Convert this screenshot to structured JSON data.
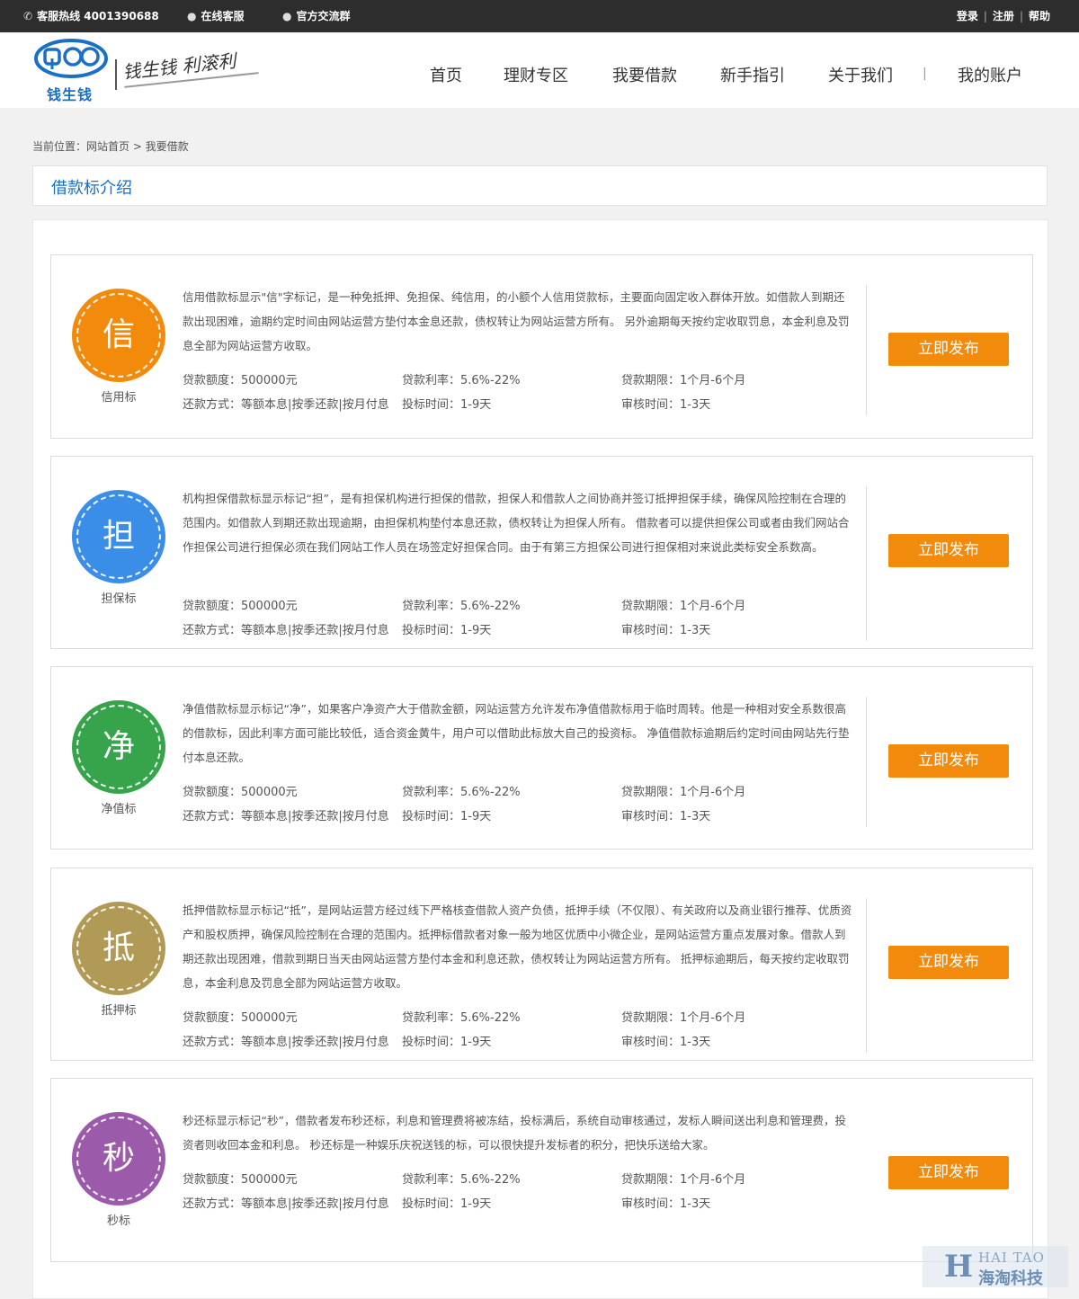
{
  "topbar": {
    "hotline": "客服热线 4001390688",
    "online_service": "在线客服",
    "group": "官方交流群",
    "login": "登录",
    "register": "注册",
    "help": "帮助",
    "sep": "|"
  },
  "header": {
    "logo_text": "钱生钱",
    "slogan": "钱生钱 利滚利",
    "nav": [
      "首页",
      "理财专区",
      "我要借款",
      "新手指引",
      "关于我们",
      "|",
      "我的账户"
    ]
  },
  "breadcrumb": "当前位置：网站首页 > 我要借款",
  "section_title": "借款标介绍",
  "colors": {
    "accent_blue": "#1a6fc6",
    "button_orange": "#f28a0c",
    "badge_xin": "#f28a0c",
    "badge_dan": "#3b8ee8",
    "badge_jing": "#36a44a",
    "badge_di": "#b09a55",
    "badge_miao": "#9c5aab"
  },
  "loans": [
    {
      "char": "信",
      "label": "信用标",
      "desc": "信用借款标显示\"信\"字标记，是一种免抵押、免担保、纯信用，的小额个人信用贷款标，主要面向固定收入群体开放。如借款人到期还款出现困难，逾期约定时间由网站运营方垫付本金息还款，债权转让为网站运营方所有。 另外逾期每天按约定收取罚息，本金利息及罚息全部为网站运营方收取。",
      "amount": "贷款额度：500000元",
      "rate": "贷款利率：5.6%-22%",
      "term": "贷款期限：1个月-6个月",
      "repay": "还款方式：等额本息|按季还款|按月付息",
      "bid_time": "投标时间：1-9天",
      "audit": "审核时间：1-3天",
      "button": "立即发布"
    },
    {
      "char": "担",
      "label": "担保标",
      "desc": "机构担保借款标显示标记“担”，是有担保机构进行担保的借款，担保人和借款人之间协商并签订抵押担保手续，确保风险控制在合理的范围内。如借款人到期还款出现逾期，由担保机构垫付本息还款，债权转让为担保人所有。 借款者可以提供担保公司或者由我们网站合作担保公司进行担保必须在我们网站工作人员在场签定好担保合同。由于有第三方担保公司进行担保相对来说此类标安全系数高。",
      "amount": "贷款额度：500000元",
      "rate": "贷款利率：5.6%-22%",
      "term": "贷款期限：1个月-6个月",
      "repay": "还款方式：等额本息|按季还款|按月付息",
      "bid_time": "投标时间：1-9天",
      "audit": "审核时间：1-3天",
      "button": "立即发布"
    },
    {
      "char": "净",
      "label": "净值标",
      "desc": "净值借款标显示标记“净”，如果客户净资产大于借款金额，网站运营方允许发布净值借款标用于临时周转。他是一种相对安全系数很高的借款标，因此利率方面可能比较低，适合资金黄牛，用户可以借助此标放大自己的投资标。 净值借款标逾期后约定时间由网站先行垫付本息还款。",
      "amount": "贷款额度：500000元",
      "rate": "贷款利率：5.6%-22%",
      "term": "贷款期限：1个月-6个月",
      "repay": "还款方式：等额本息|按季还款|按月付息",
      "bid_time": "投标时间：1-9天",
      "audit": "审核时间：1-3天",
      "button": "立即发布"
    },
    {
      "char": "抵",
      "label": "抵押标",
      "desc": "抵押借款标显示标记“抵”，是网站运营方经过线下严格核查借款人资产负债，抵押手续（不仅限）、有关政府以及商业银行推荐、优质资产和股权质押，确保风险控制在合理的范围内。抵押标借款者对象一般为地区优质中小微企业，是网站运营方重点发展对象。借款人到期还款出现困难，借款到期日当天由网站运营方垫付本金和利息还款，债权转让为网站运营方所有。 抵押标逾期后，每天按约定收取罚息，本金利息及罚息全部为网站运营方收取。",
      "amount": "贷款额度：500000元",
      "rate": "贷款利率：5.6%-22%",
      "term": "贷款期限：1个月-6个月",
      "repay": "还款方式：等额本息|按季还款|按月付息",
      "bid_time": "投标时间：1-9天",
      "audit": "审核时间：1-3天",
      "button": "立即发布"
    },
    {
      "char": "秒",
      "label": "秒标",
      "desc": "秒还标显示标记“秒”，借款者发布秒还标，利息和管理费将被冻结，投标满后，系统自动审核通过，发标人瞬间送出利息和管理费，投资者则收回本金和利息。 秒还标是一种娱乐庆祝送钱的标，可以很快提升发标者的积分，把快乐送给大家。",
      "amount": "贷款额度：500000元",
      "rate": "贷款利率：5.6%-22%",
      "term": "贷款期限：1个月-6个月",
      "repay": "还款方式：等额本息|按季还款|按月付息",
      "bid_time": "投标时间：1-9天",
      "audit": "审核时间：1-3天",
      "button": "立即发布"
    }
  ],
  "watermark": {
    "letter": "H",
    "line1": "HAI TAO",
    "line2": "海淘科技"
  }
}
